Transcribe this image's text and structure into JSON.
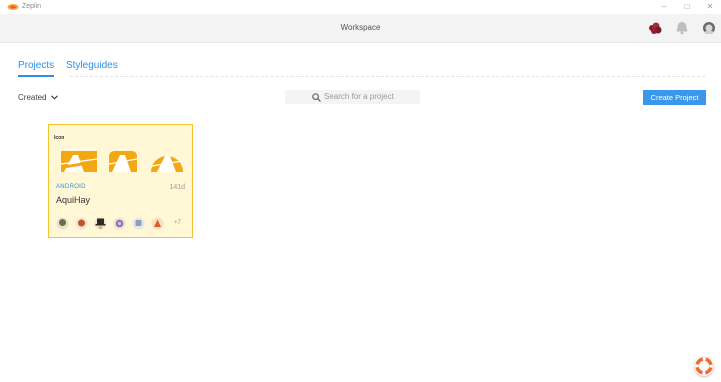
{
  "window": {
    "title": "Zeplin",
    "controls": [
      "minimize-icon",
      "maximize-icon",
      "close-icon"
    ]
  },
  "header": {
    "title": "Workspace",
    "icons": [
      "organization-avatar-icon",
      "notification-bell-icon",
      "user-avatar-icon"
    ]
  },
  "tabs": [
    {
      "label": "Projects",
      "active": true
    },
    {
      "label": "Styleguides",
      "active": false
    }
  ],
  "toolbar": {
    "sort_label": "Created",
    "search_placeholder": "Search for a project",
    "create_button": "Create Project"
  },
  "projects": [
    {
      "cover_label": "Icon",
      "platform": "ANDROID",
      "age": "141d",
      "name": "AquiHay",
      "member_avatars": [
        "avatar-1",
        "avatar-2",
        "avatar-3",
        "avatar-4",
        "avatar-5",
        "avatar-6"
      ],
      "more_members": "+7"
    }
  ],
  "colors": {
    "accent": "#2e8fe6",
    "button": "#3a97ea",
    "card_border": "#f6c22b",
    "card_bg": "#fff7d6",
    "icon_orange": "#f3a712"
  }
}
